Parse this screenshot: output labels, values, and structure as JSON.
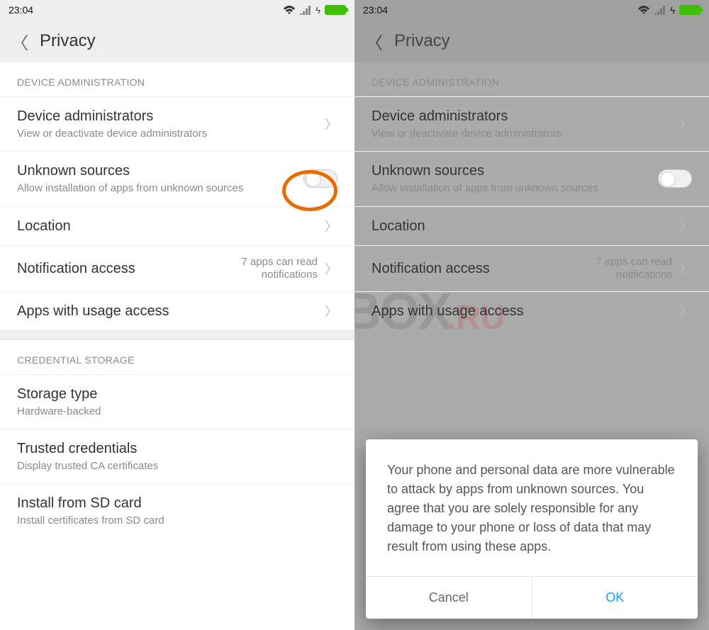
{
  "status": {
    "time": "23:04"
  },
  "header": {
    "title": "Privacy"
  },
  "sectionA": {
    "title": "DEVICE ADMINISTRATION"
  },
  "rows": {
    "admins": {
      "title": "Device administrators",
      "sub": "View or deactivate device administrators"
    },
    "unknown": {
      "title": "Unknown sources",
      "sub": "Allow installation of apps from unknown sources"
    },
    "location": {
      "title": "Location"
    },
    "notif": {
      "title": "Notification access",
      "value": "7 apps can read notifications"
    },
    "usage": {
      "title": "Apps with usage access"
    }
  },
  "sectionB": {
    "title": "CREDENTIAL STORAGE"
  },
  "rowsB": {
    "storage": {
      "title": "Storage type",
      "sub": "Hardware-backed"
    },
    "trusted": {
      "title": "Trusted credentials",
      "sub": "Display trusted CA certificates"
    },
    "install": {
      "title": "Install from SD card",
      "sub": "Install certificates from SD card"
    }
  },
  "dialog": {
    "body": "Your phone and personal data are more vulnerable to attack by apps from unknown sources. You agree that you are solely responsible for any damage to your phone or loss of data that may result from using these apps.",
    "cancel": "Cancel",
    "ok": "OK"
  },
  "watermark": {
    "t1": "MI-BOX",
    "t2": ".RU"
  }
}
